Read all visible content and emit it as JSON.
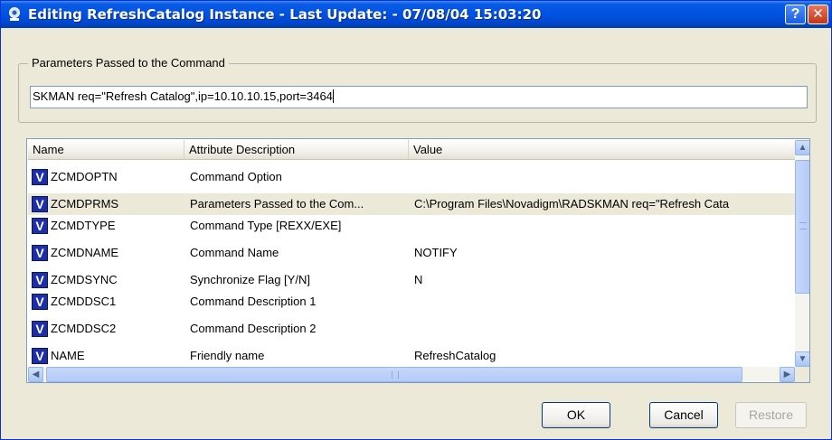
{
  "window": {
    "title": "Editing RefreshCatalog Instance - Last Update: - 07/08/04 15:03:20",
    "help_label": "?",
    "close_label": "✕"
  },
  "parameters": {
    "group_label": "Parameters Passed to the Command",
    "value": "SKMAN req=\"Refresh Catalog\",ip=10.10.10.15,port=3464"
  },
  "table": {
    "columns": [
      "Name",
      "Attribute Description",
      "Value"
    ],
    "rows": [
      {
        "icon": "V",
        "name": "ZCMDOPTN",
        "description": "Command Option",
        "value": ""
      },
      {
        "icon": "V",
        "name": "ZCMDPRMS",
        "description": "Parameters Passed to the Com...",
        "value": "C:\\Program Files\\Novadigm\\RADSKMAN req=\"Refresh Cata"
      },
      {
        "icon": "V",
        "name": "ZCMDTYPE",
        "description": "Command Type [REXX/EXE]",
        "value": ""
      },
      {
        "icon": "V",
        "name": "ZCMDNAME",
        "description": "Command Name",
        "value": "NOTIFY"
      },
      {
        "icon": "V",
        "name": "ZCMDSYNC",
        "description": "Synchronize Flag [Y/N]",
        "value": "N"
      },
      {
        "icon": "V",
        "name": "ZCMDDSC1",
        "description": "Command Description 1",
        "value": ""
      },
      {
        "icon": "V",
        "name": "ZCMDDSC2",
        "description": "Command Description 2",
        "value": ""
      },
      {
        "icon": "V",
        "name": "NAME",
        "description": "Friendly name",
        "value": "RefreshCatalog"
      }
    ]
  },
  "buttons": {
    "ok": "OK",
    "cancel": "Cancel",
    "restore": "Restore"
  },
  "scroll_arrows": {
    "up": "▲",
    "down": "▼",
    "left": "◀",
    "right": "▶"
  }
}
